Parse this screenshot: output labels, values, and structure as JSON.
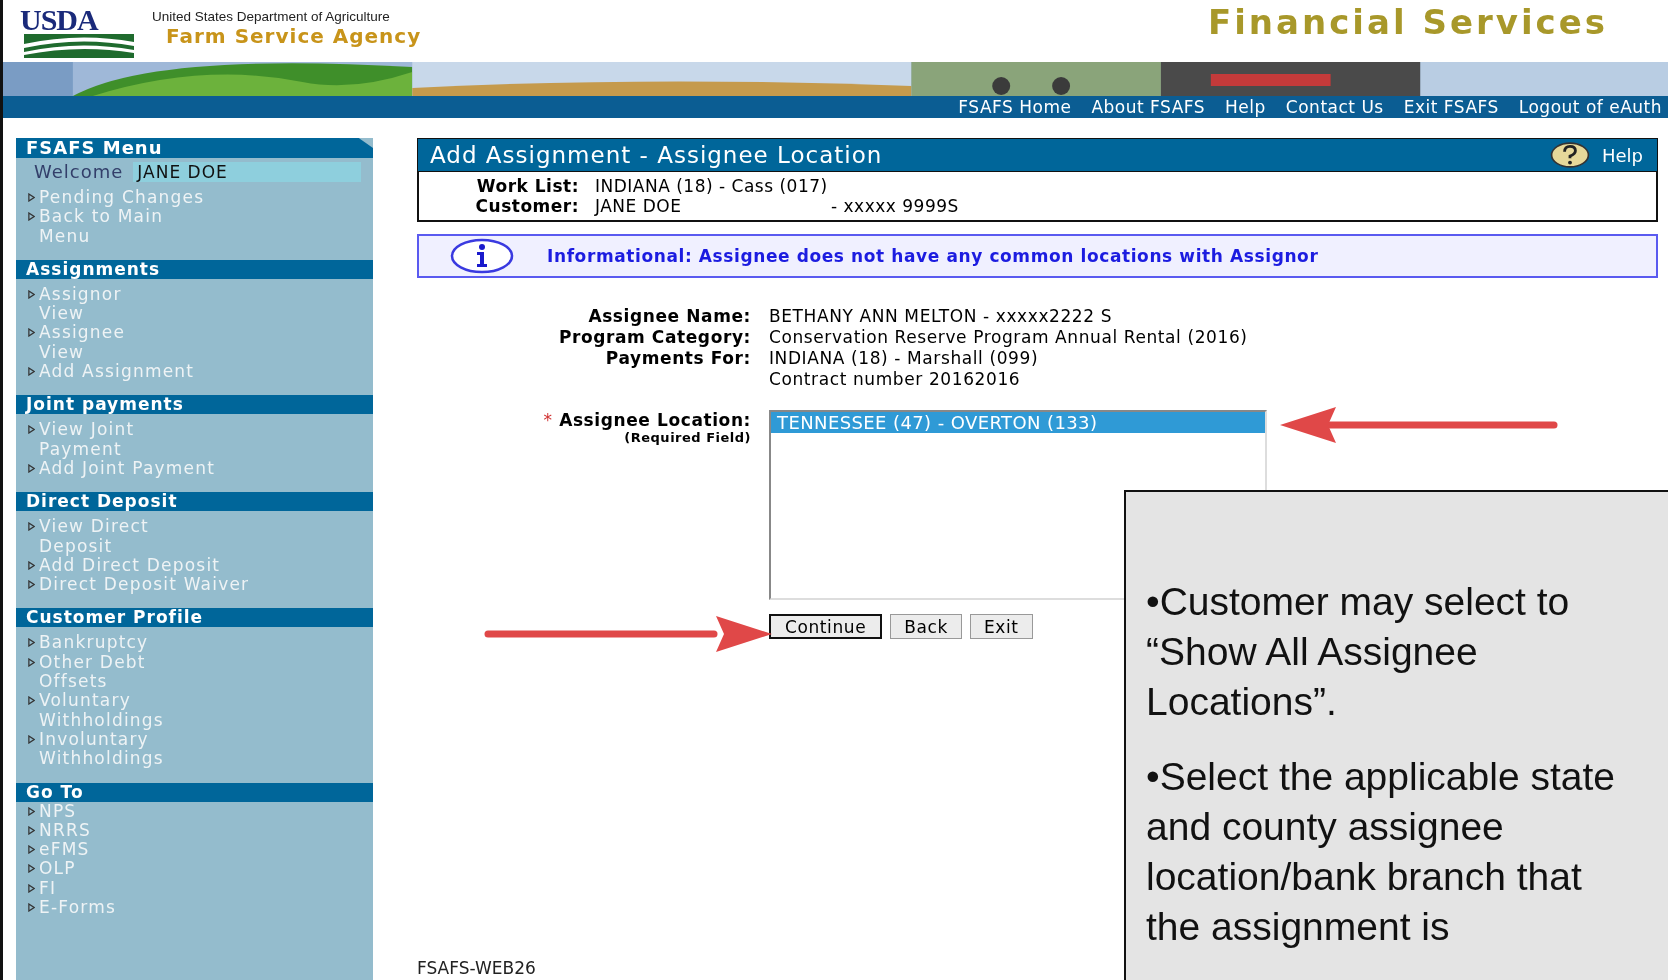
{
  "header": {
    "logo": "USDA",
    "department": "United States Department of Agriculture",
    "agency": "Farm Service Agency",
    "title": "Financial Services"
  },
  "nav": [
    "FSAFS Home",
    "About FSAFS",
    "Help",
    "Contact Us",
    "Exit FSAFS",
    "Logout of eAuth"
  ],
  "sidebar": {
    "title": "FSAFS Menu",
    "welcome": "Welcome",
    "user": "JANE DOE",
    "items": [
      "Pending Changes",
      "Back to Main\nMenu"
    ],
    "sections": [
      {
        "heading": "Assignments",
        "items": [
          "Assignor\nView",
          "Assignee\nView",
          "Add Assignment"
        ]
      },
      {
        "heading": "Joint payments",
        "items": [
          "View Joint\nPayment",
          "Add Joint Payment"
        ]
      },
      {
        "heading": "Direct Deposit",
        "items": [
          "View Direct\nDeposit",
          "Add Direct Deposit",
          "Direct Deposit Waiver"
        ]
      },
      {
        "heading": "Customer Profile",
        "items": [
          "Bankruptcy",
          "Other Debt\nOffsets",
          "Voluntary\nWithholdings",
          "Involuntary\nWithholdings"
        ]
      },
      {
        "heading": "Go To",
        "items": [
          "NPS",
          "NRRS",
          "eFMS",
          "OLP",
          "FI",
          "E-Forms"
        ]
      }
    ]
  },
  "page": {
    "title": "Add Assignment - Assignee Location",
    "help": "Help",
    "work_list_label": "Work List:",
    "work_list": "INDIANA (18) - Cass (017)",
    "customer_label": "Customer:",
    "customer": "JANE DOE",
    "customer_id": "- xxxxx 9999S"
  },
  "info": "Informational: Assignee does not have any common locations with Assignor",
  "details": [
    {
      "label": "Assignee Name:",
      "values": [
        "BETHANY ANN MELTON - xxxxx2222 S"
      ]
    },
    {
      "label": "Program Category:",
      "values": [
        "Conservation Reserve Program Annual Rental (2016)"
      ]
    },
    {
      "label": "Payments For:",
      "values": [
        "INDIANA (18) - Marshall (099)",
        "Contract number 20162016"
      ]
    }
  ],
  "location": {
    "required_mark": "*",
    "label": "Assignee Location:",
    "hint": "(Required Field)",
    "options": [
      {
        "text": "TENNESSEE (47) - OVERTON (133)",
        "selected": true
      }
    ]
  },
  "buttons": [
    {
      "label": "Continue",
      "focused": true
    },
    {
      "label": "Back",
      "focused": false
    },
    {
      "label": "Exit",
      "focused": false
    }
  ],
  "footer": "FSAFS-WEB26",
  "callout": [
    "•Customer may select to “Show All Assignee Locations”.",
    "•Select the applicable state and county assignee location/bank branch that the assignment is"
  ]
}
